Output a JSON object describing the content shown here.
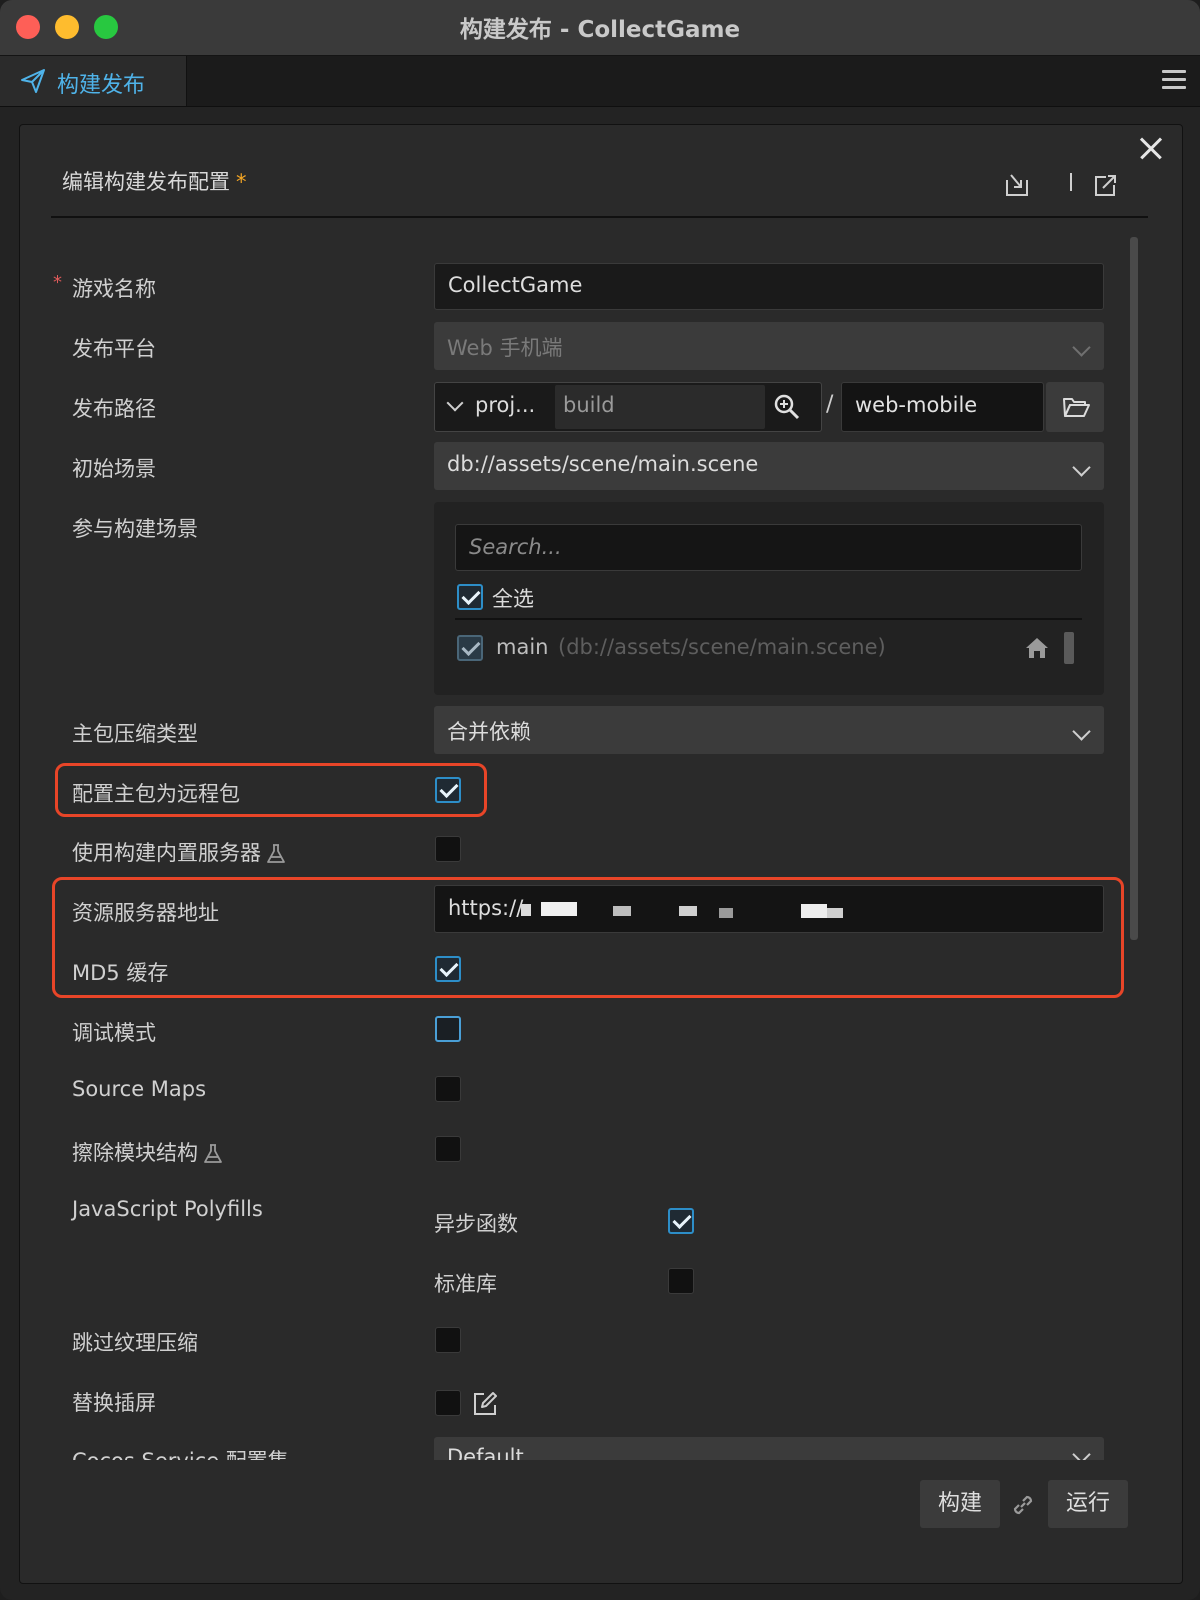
{
  "window": {
    "title": "构建发布 - CollectGame"
  },
  "tabbar": {
    "tab_label": "构建发布"
  },
  "panel": {
    "title": "编辑构建发布配置",
    "modified_marker": "*"
  },
  "form": {
    "game_name": {
      "label": "游戏名称",
      "required_marker": "*",
      "value": "CollectGame"
    },
    "platform": {
      "label": "发布平台",
      "value": "Web 手机端"
    },
    "build_path": {
      "label": "发布路径",
      "prefix": "proj...",
      "dir_value": "build",
      "separator": "/",
      "target_dir": "web-mobile"
    },
    "start_scene": {
      "label": "初始场景",
      "value": "db://assets/scene/main.scene"
    },
    "build_scenes": {
      "label": "参与构建场景",
      "search_placeholder": "Search...",
      "select_all_label": "全选",
      "select_all_checked": true,
      "scenes": [
        {
          "name": "main",
          "path": "(db://assets/scene/main.scene)",
          "checked": true
        }
      ]
    },
    "compression": {
      "label": "主包压缩类型",
      "value": "合并依赖"
    },
    "main_remote": {
      "label": "配置主包为远程包",
      "checked": true
    },
    "builtin_server": {
      "label": "使用构建内置服务器",
      "checked": false
    },
    "server_url": {
      "label": "资源服务器地址",
      "value": "https://"
    },
    "md5": {
      "label": "MD5 缓存",
      "checked": true
    },
    "debug": {
      "label": "调试模式",
      "checked": false
    },
    "source_maps": {
      "label": "Source Maps",
      "checked": false
    },
    "erase_modules": {
      "label": "擦除模块结构",
      "checked": false
    },
    "polyfills": {
      "label": "JavaScript Polyfills",
      "async_label": "异步函数",
      "async_checked": true,
      "corejs_label": "标准库",
      "corejs_checked": false
    },
    "skip_texture": {
      "label": "跳过纹理压缩",
      "checked": false
    },
    "splash": {
      "label": "替换插屏",
      "checked": false
    },
    "cocos_service": {
      "label": "Cocos Service 配置集",
      "value": "Default"
    }
  },
  "footer": {
    "build_label": "构建",
    "run_label": "运行"
  },
  "colors": {
    "accent": "#2d8ec8",
    "highlight": "#e84528",
    "tab_text": "#4fb3e9",
    "required": "#f5a623"
  },
  "icons": [
    "send-icon",
    "menu-icon",
    "close-icon",
    "import-icon",
    "export-icon",
    "search-icon",
    "folder-open-icon",
    "home-icon",
    "flask-icon",
    "edit-icon",
    "link-icon"
  ]
}
